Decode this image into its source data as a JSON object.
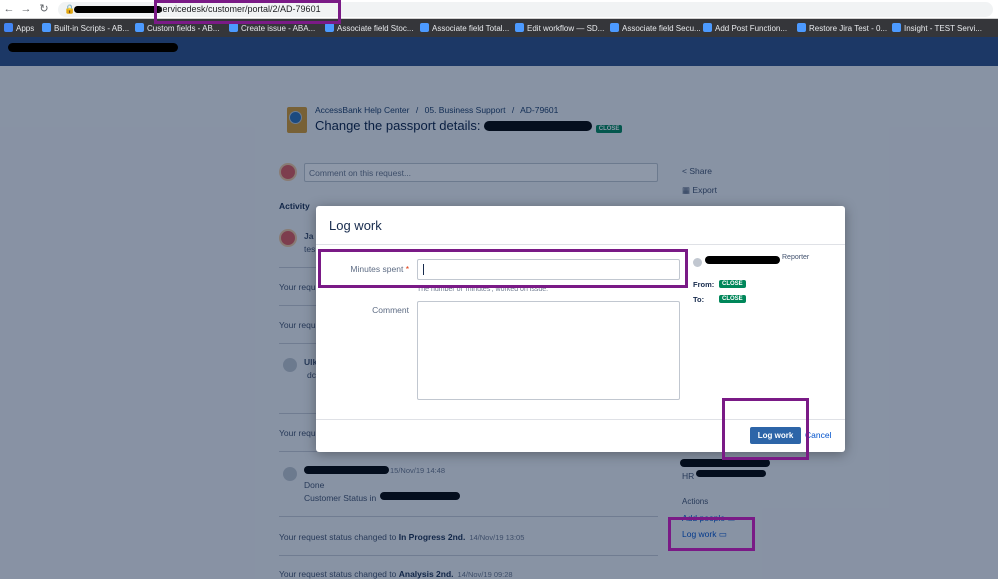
{
  "browser": {
    "url": "servicedesk/customer/portal/2/AD-79601",
    "bookmarks": [
      {
        "label": "Apps",
        "color": "#4285f4"
      },
      {
        "label": "Built-in Scripts - AB...",
        "color": "#4c9aff"
      },
      {
        "label": "Custom fields - AB...",
        "color": "#4c9aff"
      },
      {
        "label": "Create issue - ABA...",
        "color": "#4c9aff"
      },
      {
        "label": "Associate field Stoc...",
        "color": "#4c9aff"
      },
      {
        "label": "Associate field Total...",
        "color": "#4c9aff"
      },
      {
        "label": "Edit workflow — SD...",
        "color": "#4c9aff"
      },
      {
        "label": "Associate field Secu...",
        "color": "#4c9aff"
      },
      {
        "label": "Add Post Function...",
        "color": "#4c9aff"
      },
      {
        "label": "Restore Jira Test - 0...",
        "color": "#4c9aff"
      },
      {
        "label": "Insight - TEST Servi...",
        "color": "#4c9aff"
      }
    ]
  },
  "breadcrumb": {
    "portal": "AccessBank Help Center",
    "sep": "/",
    "group": "05. Business Support",
    "issue": "AD-79601"
  },
  "request": {
    "title": "Change the passport details:",
    "status": "CLOSE"
  },
  "comment_placeholder": "Comment on this request...",
  "side": {
    "share": "Share",
    "export": "Export",
    "actions_heading": "Actions",
    "add_people": "Add people",
    "log_work": "Log work",
    "hr": "HR"
  },
  "activity": {
    "heading": "Activity",
    "ja": "Ja",
    "tes": "tes",
    "your_req": "Your requ",
    "ulk": "Ulk",
    "dc": "dc",
    "entry_time": "15/Nov/19 14:48",
    "done": "Done",
    "customer_status": "Customer Status in",
    "status1_text": "Your request status changed to",
    "status1_value": "In Progress 2nd.",
    "status1_time": "14/Nov/19 13:05",
    "status2_text": "Your request status changed to",
    "status2_value": "Analysis 2nd.",
    "status2_time": "14/Nov/19 09:28"
  },
  "modal": {
    "title": "Log work",
    "minutes_label": "Minutes spent",
    "required_mark": "*",
    "minutes_value": "",
    "minutes_hint": "The number of 'minutes', worked on issue.",
    "comment_label": "Comment",
    "comment_value": "",
    "reporter": "Reporter",
    "from_label": "From:",
    "from_status": "CLOSE",
    "to_label": "To:",
    "to_status": "CLOSE",
    "submit": "Log work",
    "cancel": "Cancel"
  },
  "colors": {
    "header": "#1c3866",
    "lozenge": "#00875a",
    "primary": "#2d65a8",
    "highlight": "#7a1a86"
  }
}
